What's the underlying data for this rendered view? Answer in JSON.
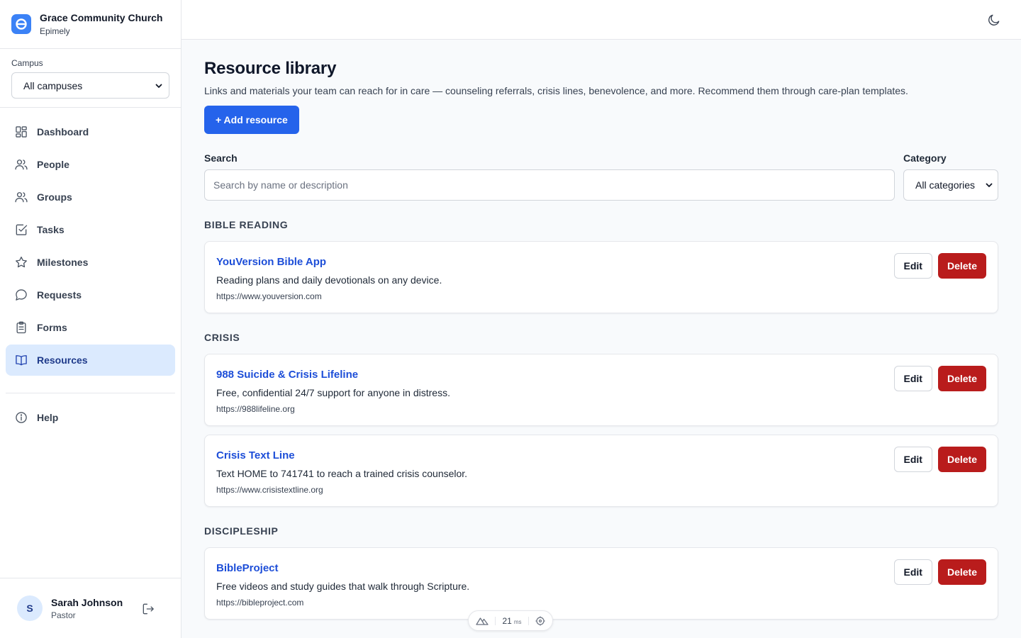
{
  "org": {
    "name": "Grace Community Church",
    "app": "Epimely"
  },
  "campus": {
    "label": "Campus",
    "selected": "All campuses"
  },
  "nav": {
    "items": [
      {
        "label": "Dashboard",
        "icon": "dashboard-icon"
      },
      {
        "label": "People",
        "icon": "people-icon"
      },
      {
        "label": "Groups",
        "icon": "groups-icon"
      },
      {
        "label": "Tasks",
        "icon": "tasks-icon"
      },
      {
        "label": "Milestones",
        "icon": "star-icon"
      },
      {
        "label": "Requests",
        "icon": "chat-bubble-icon"
      },
      {
        "label": "Forms",
        "icon": "clipboard-icon"
      },
      {
        "label": "Resources",
        "icon": "book-icon",
        "active": true
      }
    ],
    "help": "Help"
  },
  "user": {
    "initial": "S",
    "name": "Sarah Johnson",
    "role": "Pastor"
  },
  "page": {
    "title": "Resource library",
    "description": "Links and materials your team can reach for in care — counseling referrals, crisis lines, benevolence, and more. Recommend them through care-plan templates.",
    "add_button": "+ Add resource"
  },
  "filters": {
    "search_label": "Search",
    "search_placeholder": "Search by name or description",
    "category_label": "Category",
    "category_selected": "All categories"
  },
  "actions": {
    "edit": "Edit",
    "delete": "Delete"
  },
  "sections": [
    {
      "heading": "BIBLE READING",
      "resources": [
        {
          "title": "YouVersion Bible App",
          "description": "Reading plans and daily devotionals on any device.",
          "url": "https://www.youversion.com"
        }
      ]
    },
    {
      "heading": "CRISIS",
      "resources": [
        {
          "title": "988 Suicide & Crisis Lifeline",
          "description": "Free, confidential 24/7 support for anyone in distress.",
          "url": "https://988lifeline.org"
        },
        {
          "title": "Crisis Text Line",
          "description": "Text HOME to 741741 to reach a trained crisis counselor.",
          "url": "https://www.crisistextline.org"
        }
      ]
    },
    {
      "heading": "DISCIPLESHIP",
      "resources": [
        {
          "title": "BibleProject",
          "description": "Free videos and study guides that walk through Scripture.",
          "url": "https://bibleproject.com"
        }
      ]
    }
  ],
  "devtools": {
    "value": "21",
    "unit": "ms"
  },
  "colors": {
    "primary": "#2563eb",
    "danger": "#b91c1c",
    "active_nav_bg": "#dbeafe",
    "link": "#1d4ed8"
  }
}
